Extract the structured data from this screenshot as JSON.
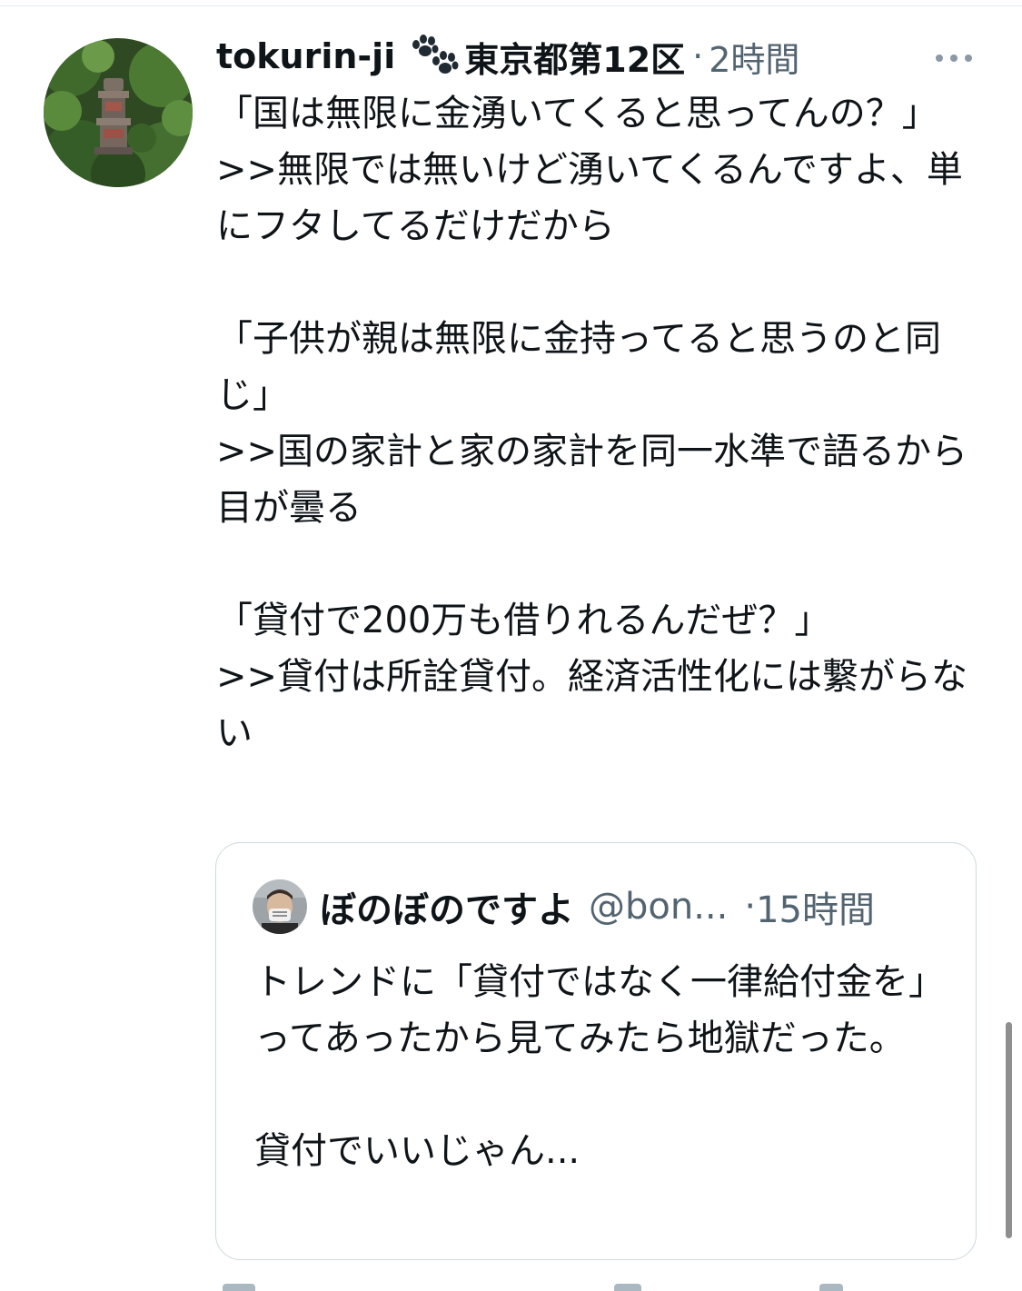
{
  "tweet": {
    "display_name": "tokurin-ji",
    "name_emoji": "paw-prints-icon",
    "location": "東京都第12区",
    "separator": "·",
    "time": "2時間",
    "more_icon": "more-horizontal-icon",
    "text": "「国は無限に金湧いてくると思ってんの？」\n>>無限では無いけど湧いてくるんですよ、単にフタしてるだけだから\n\n「子供が親は無限に金持ってると思うのと同じ」\n>>国の家計と家の家計を同一水準で語るから目が曇る\n\n「貸付で200万も借りれるんだぜ？」\n>>貸付は所詮貸付。経済活性化には繋がらない"
  },
  "quote": {
    "display_name": "ぼのぼのですよ",
    "handle": "@bon...",
    "separator": "·",
    "time": "15時間",
    "text": "トレンドに「貸付ではなく一律給付金を」ってあったから見てみたら地獄だった。\n\n貸付でいいじゃん..."
  },
  "colors": {
    "text": "#0f1419",
    "secondary": "#536471",
    "border": "#cfd9de",
    "scrollbar": "#8f8f8f"
  }
}
